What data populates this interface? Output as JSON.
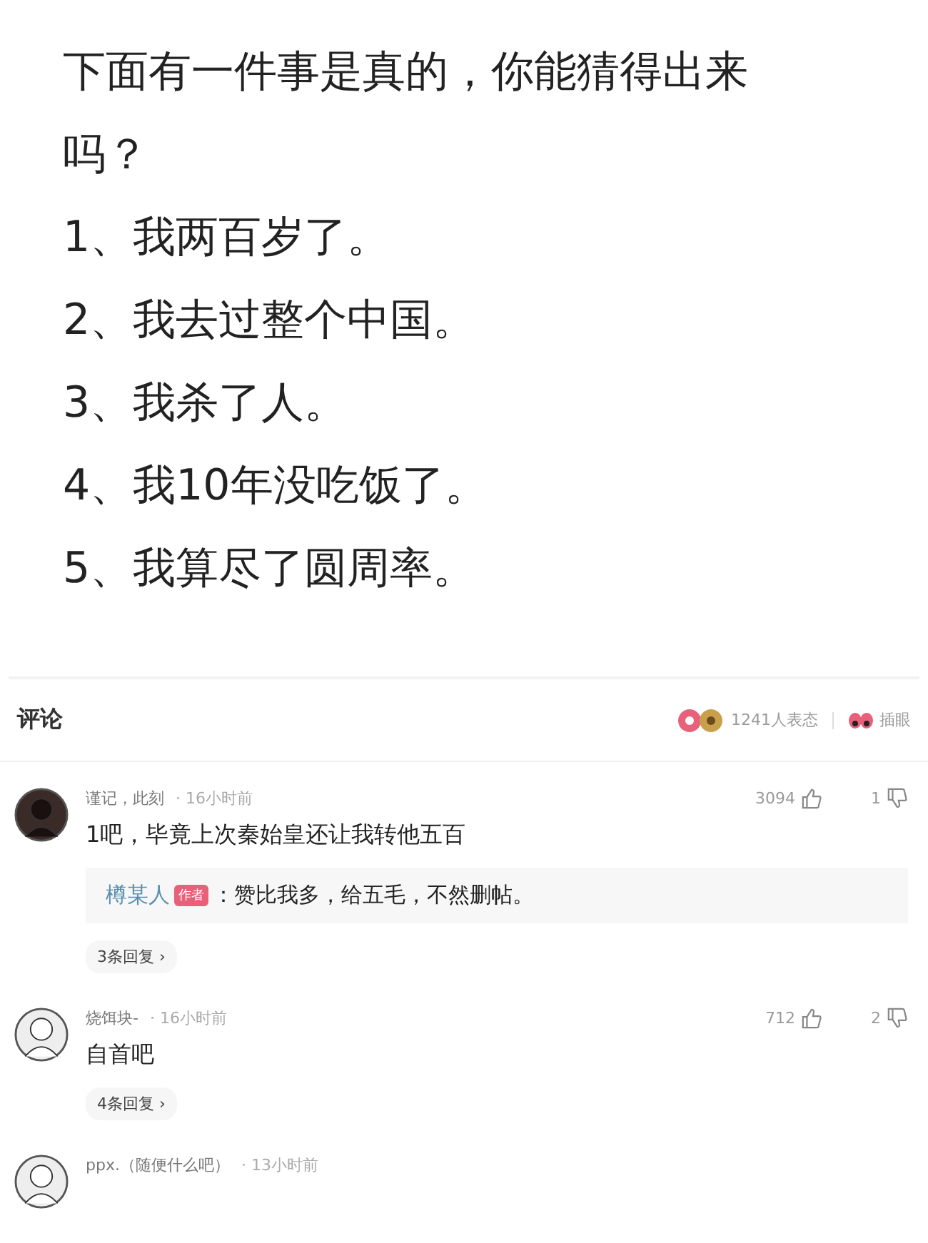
{
  "post": {
    "question": "下面有一件事是真的，你能猜得出来吗？",
    "options": [
      "1、我两百岁了。",
      "2、我去过整个中国。",
      "3、我杀了人。",
      "4、我10年没吃饭了。",
      "5、我算尽了圆周率。"
    ]
  },
  "comments_header": {
    "title": "评论",
    "reactions": "1241人表态",
    "action": "插眼"
  },
  "comments": [
    {
      "user": "谨记，此刻",
      "time": "· 16小时前",
      "likes": "3094",
      "dislikes": "1",
      "text": "1吧，毕竟上次秦始皇还让我转他五百",
      "reply": {
        "user": "樽某人",
        "badge": "作者",
        "text": "：赞比我多，给五毛，不然删帖。"
      },
      "replies_link": "3条回复 ›"
    },
    {
      "user": "烧饵块-",
      "time": "· 16小时前",
      "likes": "712",
      "dislikes": "2",
      "text": "自首吧",
      "replies_link": "4条回复 ›"
    },
    {
      "user": "ppx.（随便什么吧）",
      "time": "· 13小时前"
    }
  ]
}
